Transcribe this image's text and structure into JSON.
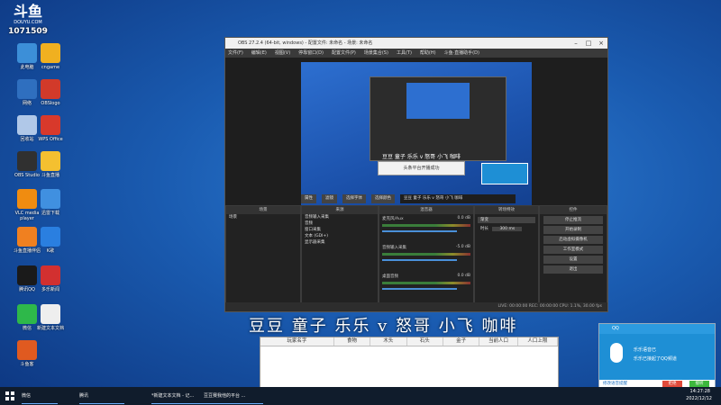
{
  "desktop": {
    "logo_text": "斗鱼",
    "logo_sub": "DOUYU.COM",
    "room_id": "1071509",
    "icons": [
      {
        "label": "此电脑",
        "color": "#3c8fd8"
      },
      {
        "label": "cngame",
        "color": "#f0b020"
      },
      {
        "label": "网络",
        "color": "#2f6fbf"
      },
      {
        "label": "OBSlogo",
        "color": "#d23a2a"
      },
      {
        "label": "回收站",
        "color": "#b0c8e8"
      },
      {
        "label": "WPS Office",
        "color": "#d8392b"
      },
      {
        "label": "OBS Studio",
        "color": "#303030"
      },
      {
        "label": "斗鱼直播",
        "color": "#f4c030"
      },
      {
        "label": "VLC media player",
        "color": "#f08c10"
      },
      {
        "label": "迅雷下载",
        "color": "#4090e0"
      },
      {
        "label": "斗鱼直播伴侣",
        "color": "#f08020"
      },
      {
        "label": "K歌",
        "color": "#2a7fe0"
      },
      {
        "label": "腾讯QQ",
        "color": "#1a1a1a"
      },
      {
        "label": "多乐新闻",
        "color": "#d23030"
      },
      {
        "label": "微信",
        "color": "#2eb84a"
      },
      {
        "label": "新建文本文档",
        "color": "#eeeeee"
      },
      {
        "label": "斗鱼客",
        "color": "#e05a20"
      }
    ]
  },
  "obs": {
    "title": "OBS 27.2.4 (64-bit, windows) - 配置文件: 未命名 - 场景: 未命名",
    "menu": [
      "文件(F)",
      "编辑(E)",
      "视图(V)",
      "停靠窗口(D)",
      "配置文件(P)",
      "场景集合(S)",
      "工具(T)",
      "帮助(H)",
      "斗鱼·直播助手(D)"
    ],
    "source_toolbar": "文本 (GDI+)",
    "toolbar_buttons": [
      "属性",
      "滤镜",
      "选择字体",
      "选择颜色"
    ],
    "toolbar_text": "豆豆 童子 乐乐 v 怒哥 小飞 咖啡",
    "panels": {
      "scenes": {
        "title": "场景",
        "items": [
          "场景"
        ]
      },
      "sources": {
        "title": "来源",
        "items": [
          "音频输入采集",
          "音频",
          "窗口采集",
          "文本 (GDI+)",
          "显示器采集"
        ]
      },
      "mixer": {
        "title": "混音器",
        "channels": [
          {
            "name": "麦克风/Aux",
            "level": "0.0 dB"
          },
          {
            "name": "音频输入采集",
            "level": "-5.0 dB"
          },
          {
            "name": "桌面音频",
            "level": "0.0 dB"
          }
        ]
      },
      "transitions": {
        "title": "转场特效",
        "type": "渐变",
        "duration_label": "时长",
        "duration": "300 ms"
      },
      "controls": {
        "title": "控件",
        "buttons": [
          "停止推流",
          "开始录制",
          "启动虚拟摄像机",
          "工作室模式",
          "设置",
          "退出"
        ]
      }
    },
    "status": "LIVE: 00:00:00   REC: 00:00:00   CPU: 1.1%, 30.00 fps",
    "preview_popup": "头条平台开播成功"
  },
  "names_banner": "豆豆 童子 乐乐 v 怒哥 小飞 咖啡",
  "table": {
    "headers": [
      "玩家名字",
      "食物",
      "木头",
      "石头",
      "金子",
      "当前人口",
      "人口上限"
    ]
  },
  "qq_popup": {
    "title": "QQ",
    "message_line1": "乐乐语音已",
    "message_line2": "乐乐已接起了QQ频道",
    "footer_link": "修改语音提醒",
    "btn_decline": "拒绝",
    "btn_accept": "接听"
  },
  "taskbar": {
    "items": [
      "微信",
      "腾讯",
      "*新建文本文档 - 记...",
      "豆豆赛我他的平台 ..."
    ],
    "time": "14:27:28",
    "date": "2022/12/12"
  }
}
